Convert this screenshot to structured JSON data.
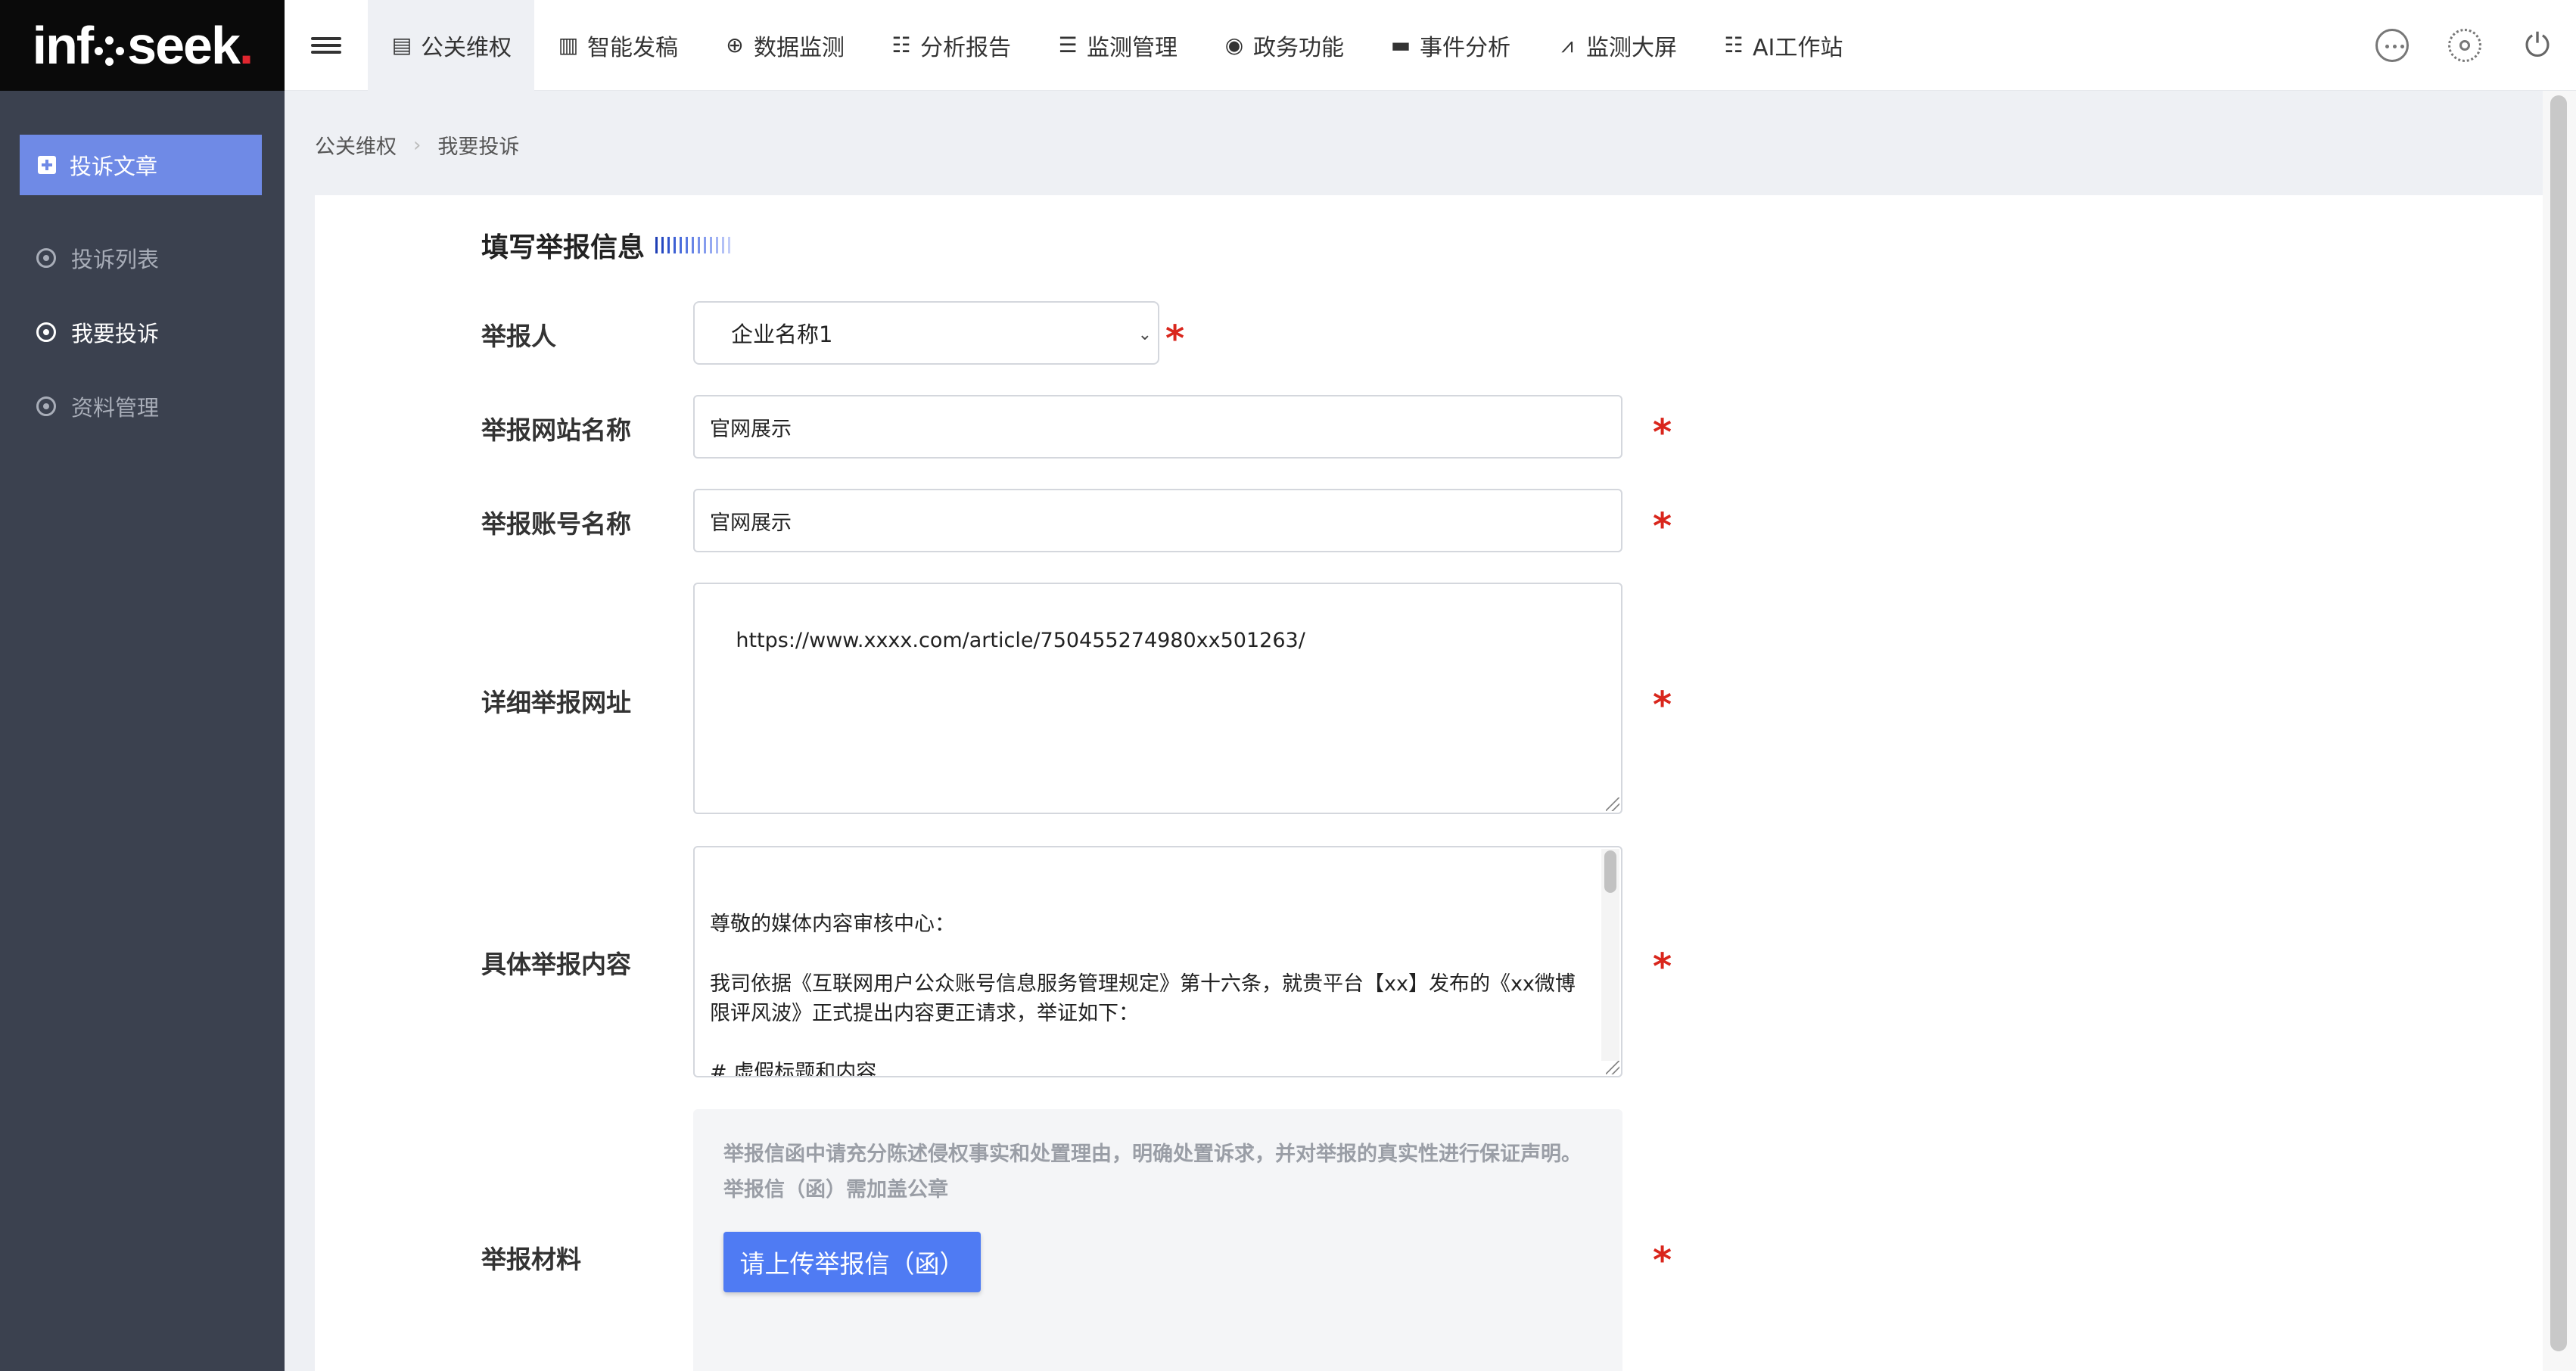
{
  "brand": {
    "logo_prefix": "inf",
    "logo_suffix": "seek",
    "logo_dot": "."
  },
  "topnav": {
    "items": [
      {
        "label": "公关维权",
        "icon": "list-alt-icon",
        "active": true
      },
      {
        "label": "智能发稿",
        "icon": "bar-chart-icon"
      },
      {
        "label": "数据监测",
        "icon": "crosshair-icon"
      },
      {
        "label": "分析报告",
        "icon": "checklist-icon"
      },
      {
        "label": "监测管理",
        "icon": "list-icon"
      },
      {
        "label": "政务功能",
        "icon": "podcast-icon"
      },
      {
        "label": "事件分析",
        "icon": "card-icon"
      },
      {
        "label": "监测大屏",
        "icon": "line-chart-icon"
      },
      {
        "label": "AI工作站",
        "icon": "checklist-icon"
      }
    ]
  },
  "sidebar": {
    "primary": "投诉文章",
    "items": [
      {
        "label": "投诉列表",
        "active": false
      },
      {
        "label": "我要投诉",
        "active": true
      },
      {
        "label": "资料管理",
        "active": false
      }
    ]
  },
  "breadcrumb": {
    "root": "公关维权",
    "current": "我要投诉"
  },
  "form": {
    "section_title": "填写举报信息",
    "reporter": {
      "label": "举报人",
      "value": "企业名称1"
    },
    "site_name": {
      "label": "举报网站名称",
      "value": "官网展示"
    },
    "account_name": {
      "label": "举报账号名称",
      "value": "官网展示"
    },
    "detail_url": {
      "label": "详细举报网址",
      "value": "https://www.xxxx.com/article/750455274980xx501263/"
    },
    "content": {
      "label": "具体举报内容",
      "value": "尊敬的媒体内容审核中心：\n\n我司依据《互联网用户公众账号信息服务管理规定》第十六条，就贵平台【xx】发布的《xx微博限评风波》正式提出内容更正请求，举证如下：\n\n# 虚假标题和内容\n\n标题：《xx微博限评风波》"
    },
    "material": {
      "label": "举报材料",
      "hint": "举报信函中请充分陈述侵权事实和处置理由，明确处置诉求，并对举报的真实性进行保证声明。举报信（函）需加盖公章",
      "upload_label": "请上传举报信（函）"
    },
    "required_mark": "*"
  },
  "colors": {
    "accent": "#4f7bf3",
    "sidebar_bg": "#3b414f",
    "required": "#d9261c"
  }
}
